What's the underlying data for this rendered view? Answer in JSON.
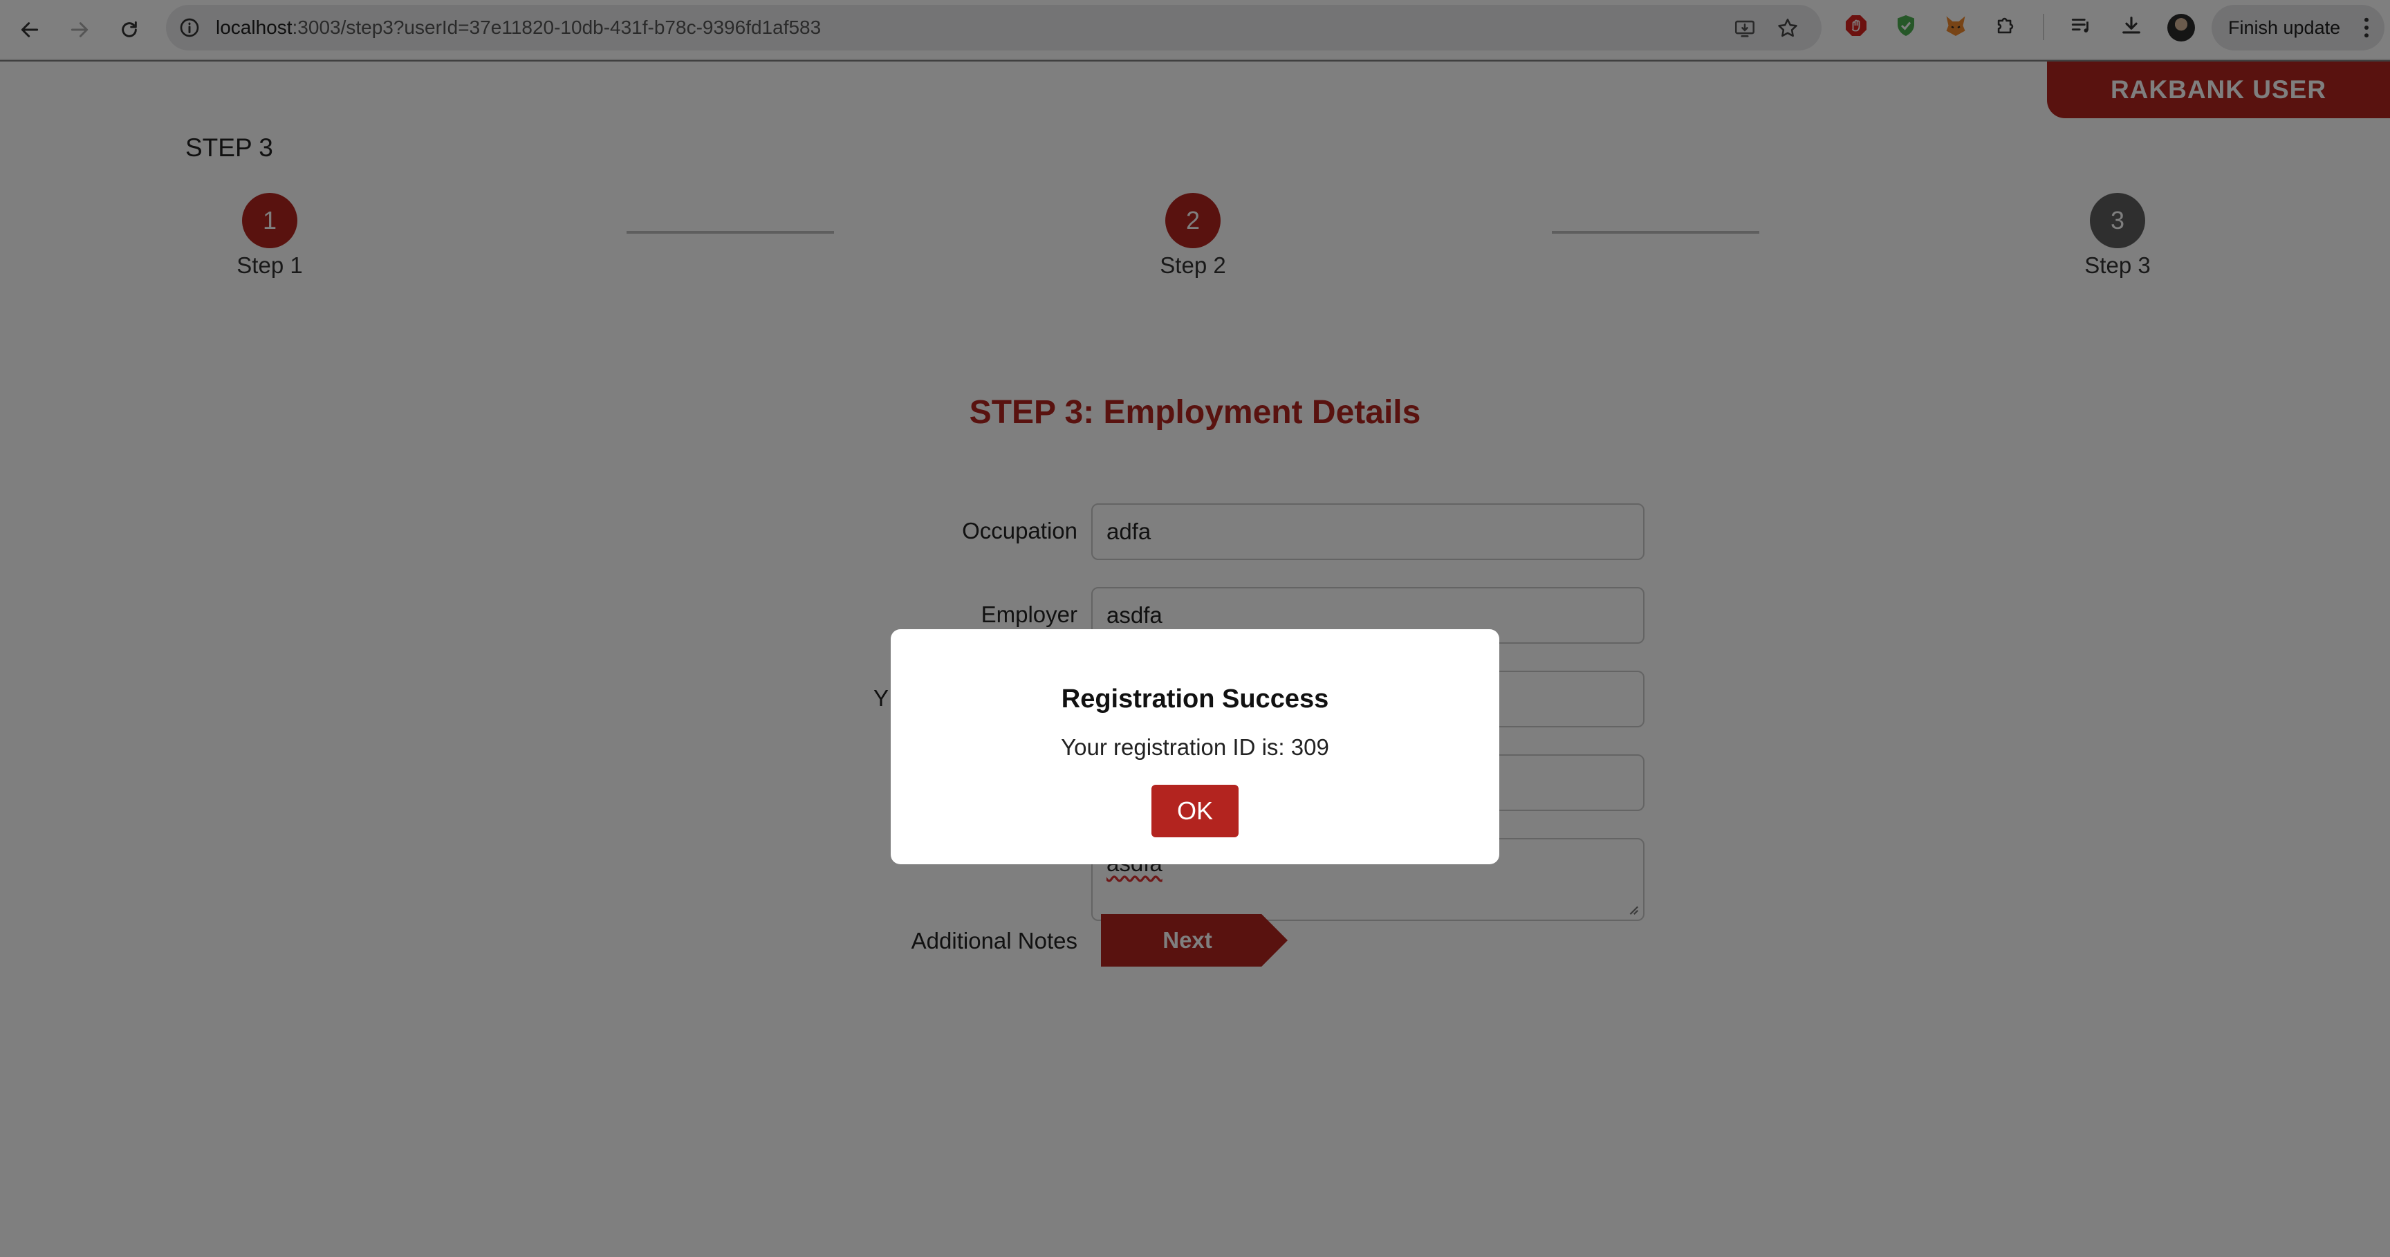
{
  "browser": {
    "url_host": "localhost",
    "url_rest": ":3003/step3?userId=37e11820-10db-431f-b78c-9396fd1af583",
    "finish_update_label": "Finish update",
    "icons": [
      "back-icon",
      "forward-icon",
      "reload-icon",
      "site-info-icon",
      "install-app-icon",
      "bookmark-star-icon",
      "adblock-extension-icon",
      "shield-extension-icon",
      "fox-extension-icon",
      "extensions-puzzle-icon",
      "media-playlist-icon",
      "downloads-icon",
      "profile-avatar",
      "more-menu-icon"
    ]
  },
  "header": {
    "user_tab": "RAKBANK USER"
  },
  "page": {
    "step_heading": "STEP 3"
  },
  "stepper": {
    "steps": [
      {
        "number": "1",
        "label": "Step 1",
        "state": "active"
      },
      {
        "number": "2",
        "label": "Step 2",
        "state": "active"
      },
      {
        "number": "3",
        "label": "Step 3",
        "state": "inactive"
      }
    ]
  },
  "form": {
    "title": "STEP 3: Employment Details",
    "fields": [
      {
        "label": "Occupation",
        "value": "adfa"
      },
      {
        "label": "Employer",
        "value": "asdfa"
      },
      {
        "label": "Y",
        "value": ""
      },
      {
        "label": "",
        "value": ""
      },
      {
        "label": "Additional Notes",
        "value": "asdfa"
      }
    ],
    "next_label": "Next"
  },
  "modal": {
    "title": "Registration Success",
    "message": "Your registration ID is: 309",
    "ok_label": "OK"
  },
  "colors": {
    "brand_red": "#b3241f",
    "inactive_step": "#5e5e5e",
    "overlay": "rgba(0,0,0,0.5)"
  }
}
